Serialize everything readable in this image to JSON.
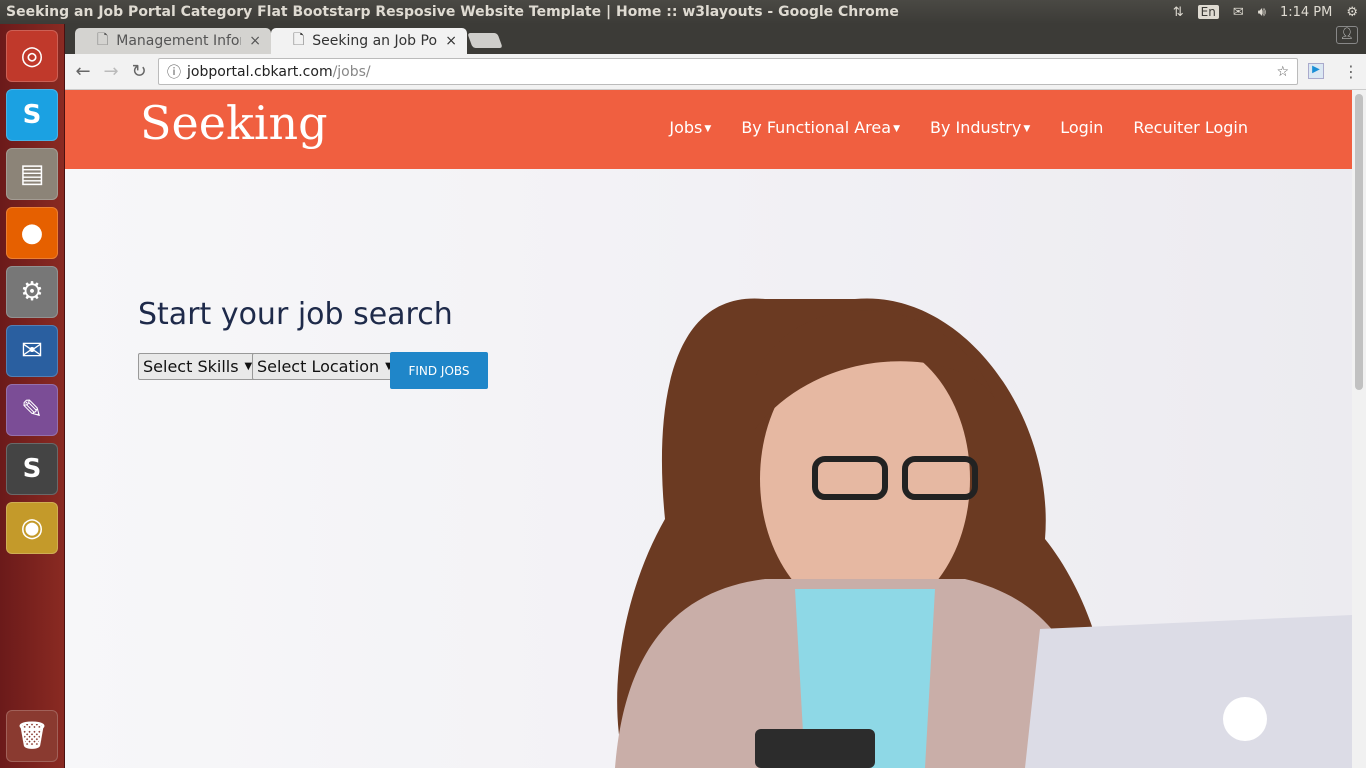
{
  "window": {
    "title": "Seeking an Job Portal Category Flat Bootstarp Resposive Website Template | Home :: w3layouts - Google Chrome"
  },
  "tray": {
    "lang": "En",
    "time": "1:14 PM"
  },
  "tabs": [
    {
      "label": "Management Inform"
    },
    {
      "label": "Seeking an Job Port"
    }
  ],
  "address": {
    "host": "jobportal.cbkart.com",
    "path": "/jobs/"
  },
  "site": {
    "logo": "Seeking",
    "nav": [
      {
        "label": "Jobs",
        "dropdown": true
      },
      {
        "label": "By Functional Area",
        "dropdown": true
      },
      {
        "label": "By Industry",
        "dropdown": true
      },
      {
        "label": "Login"
      },
      {
        "label": "Recuiter Login"
      }
    ]
  },
  "hero": {
    "heading": "Start your job search",
    "skills": "Select Skills",
    "location": "Select Location",
    "button": "FIND JOBS"
  },
  "colors": {
    "brand": "#f05f40",
    "button": "#1f86c9"
  }
}
